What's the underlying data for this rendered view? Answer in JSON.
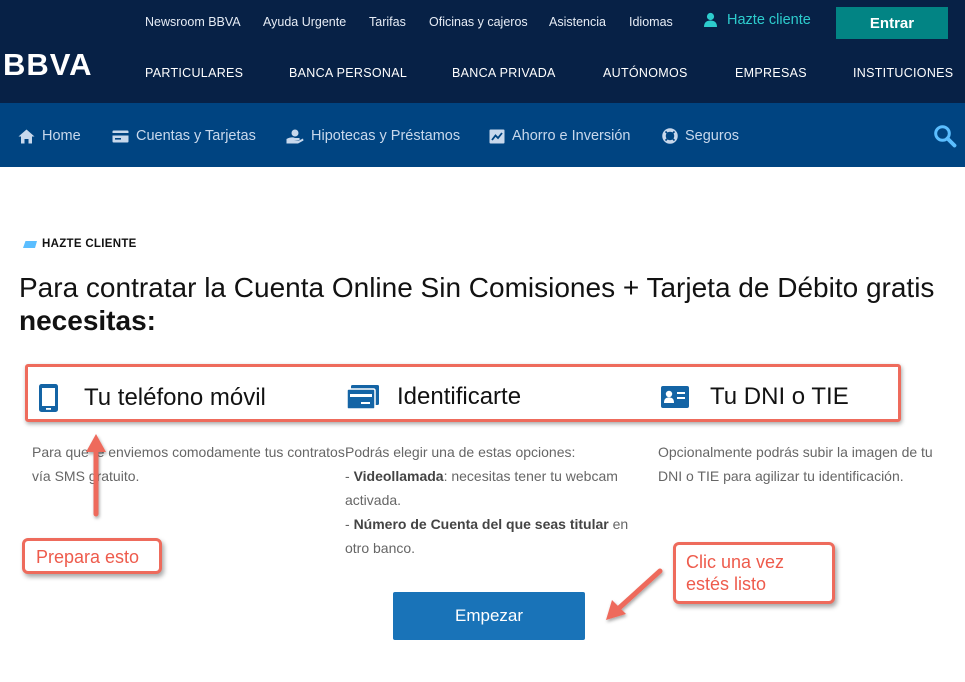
{
  "header": {
    "utility_links": [
      {
        "label": "Newsroom BBVA"
      },
      {
        "label": "Ayuda Urgente"
      },
      {
        "label": "Tarifas"
      },
      {
        "label": "Oficinas y cajeros"
      },
      {
        "label": "Asistencia"
      },
      {
        "label": "Idiomas"
      }
    ],
    "hazte_cliente": "Hazte cliente",
    "entrar": "Entrar",
    "logo": "BBVA",
    "main_nav": [
      {
        "label": "PARTICULARES"
      },
      {
        "label": "BANCA PERSONAL"
      },
      {
        "label": "BANCA PRIVADA"
      },
      {
        "label": "AUTÓNOMOS"
      },
      {
        "label": "EMPRESAS"
      },
      {
        "label": "INSTITUCIONES"
      }
    ]
  },
  "sub_nav": [
    {
      "label": "Home",
      "icon": "home-icon"
    },
    {
      "label": "Cuentas y Tarjetas",
      "icon": "card-icon"
    },
    {
      "label": "Hipotecas y Préstamos",
      "icon": "hand-coin-icon"
    },
    {
      "label": "Ahorro e Inversión",
      "icon": "chart-icon"
    },
    {
      "label": "Seguros",
      "icon": "lifebuoy-icon"
    }
  ],
  "content": {
    "eyebrow": "HAZTE CLIENTE",
    "headline": "Para contratar la Cuenta Online Sin Comisiones + Tarjeta de Débito gratis",
    "headline_bold": "necesitas:",
    "requirements": [
      {
        "title": "Tu teléfono móvil",
        "icon": "mobile-phone-icon",
        "desc_1": "Para que te enviemos comodamente tus contratos",
        "desc_2": "vía SMS gratuito."
      },
      {
        "title": "Identificarte",
        "icon": "id-card-icon",
        "desc_1": "Podrás elegir una de estas opciones:",
        "desc_2_bold": "Videollamada",
        "desc_2_rest": ": necesitas tener tu webcam",
        "desc_3": "activada.",
        "desc_4_bold": "Número de Cuenta del que seas titular",
        "desc_4_rest": " en",
        "desc_5": "otro banco."
      },
      {
        "title": "Tu DNI o TIE",
        "icon": "dni-card-icon",
        "desc_1": "Opcionalmente podrás subir la imagen de tu",
        "desc_2": "DNI o TIE para agilizar tu identificación."
      }
    ],
    "cta": "Empezar"
  },
  "annotations": {
    "prepara": "Prepara esto",
    "clic_1": "Clic una vez",
    "clic_2": "estés listo"
  },
  "colors": {
    "header_bg": "#072146",
    "subnav_bg": "#004481",
    "accent_teal": "#028484",
    "cta_blue": "#1973b8",
    "annotation_red": "#ee6b5c"
  }
}
